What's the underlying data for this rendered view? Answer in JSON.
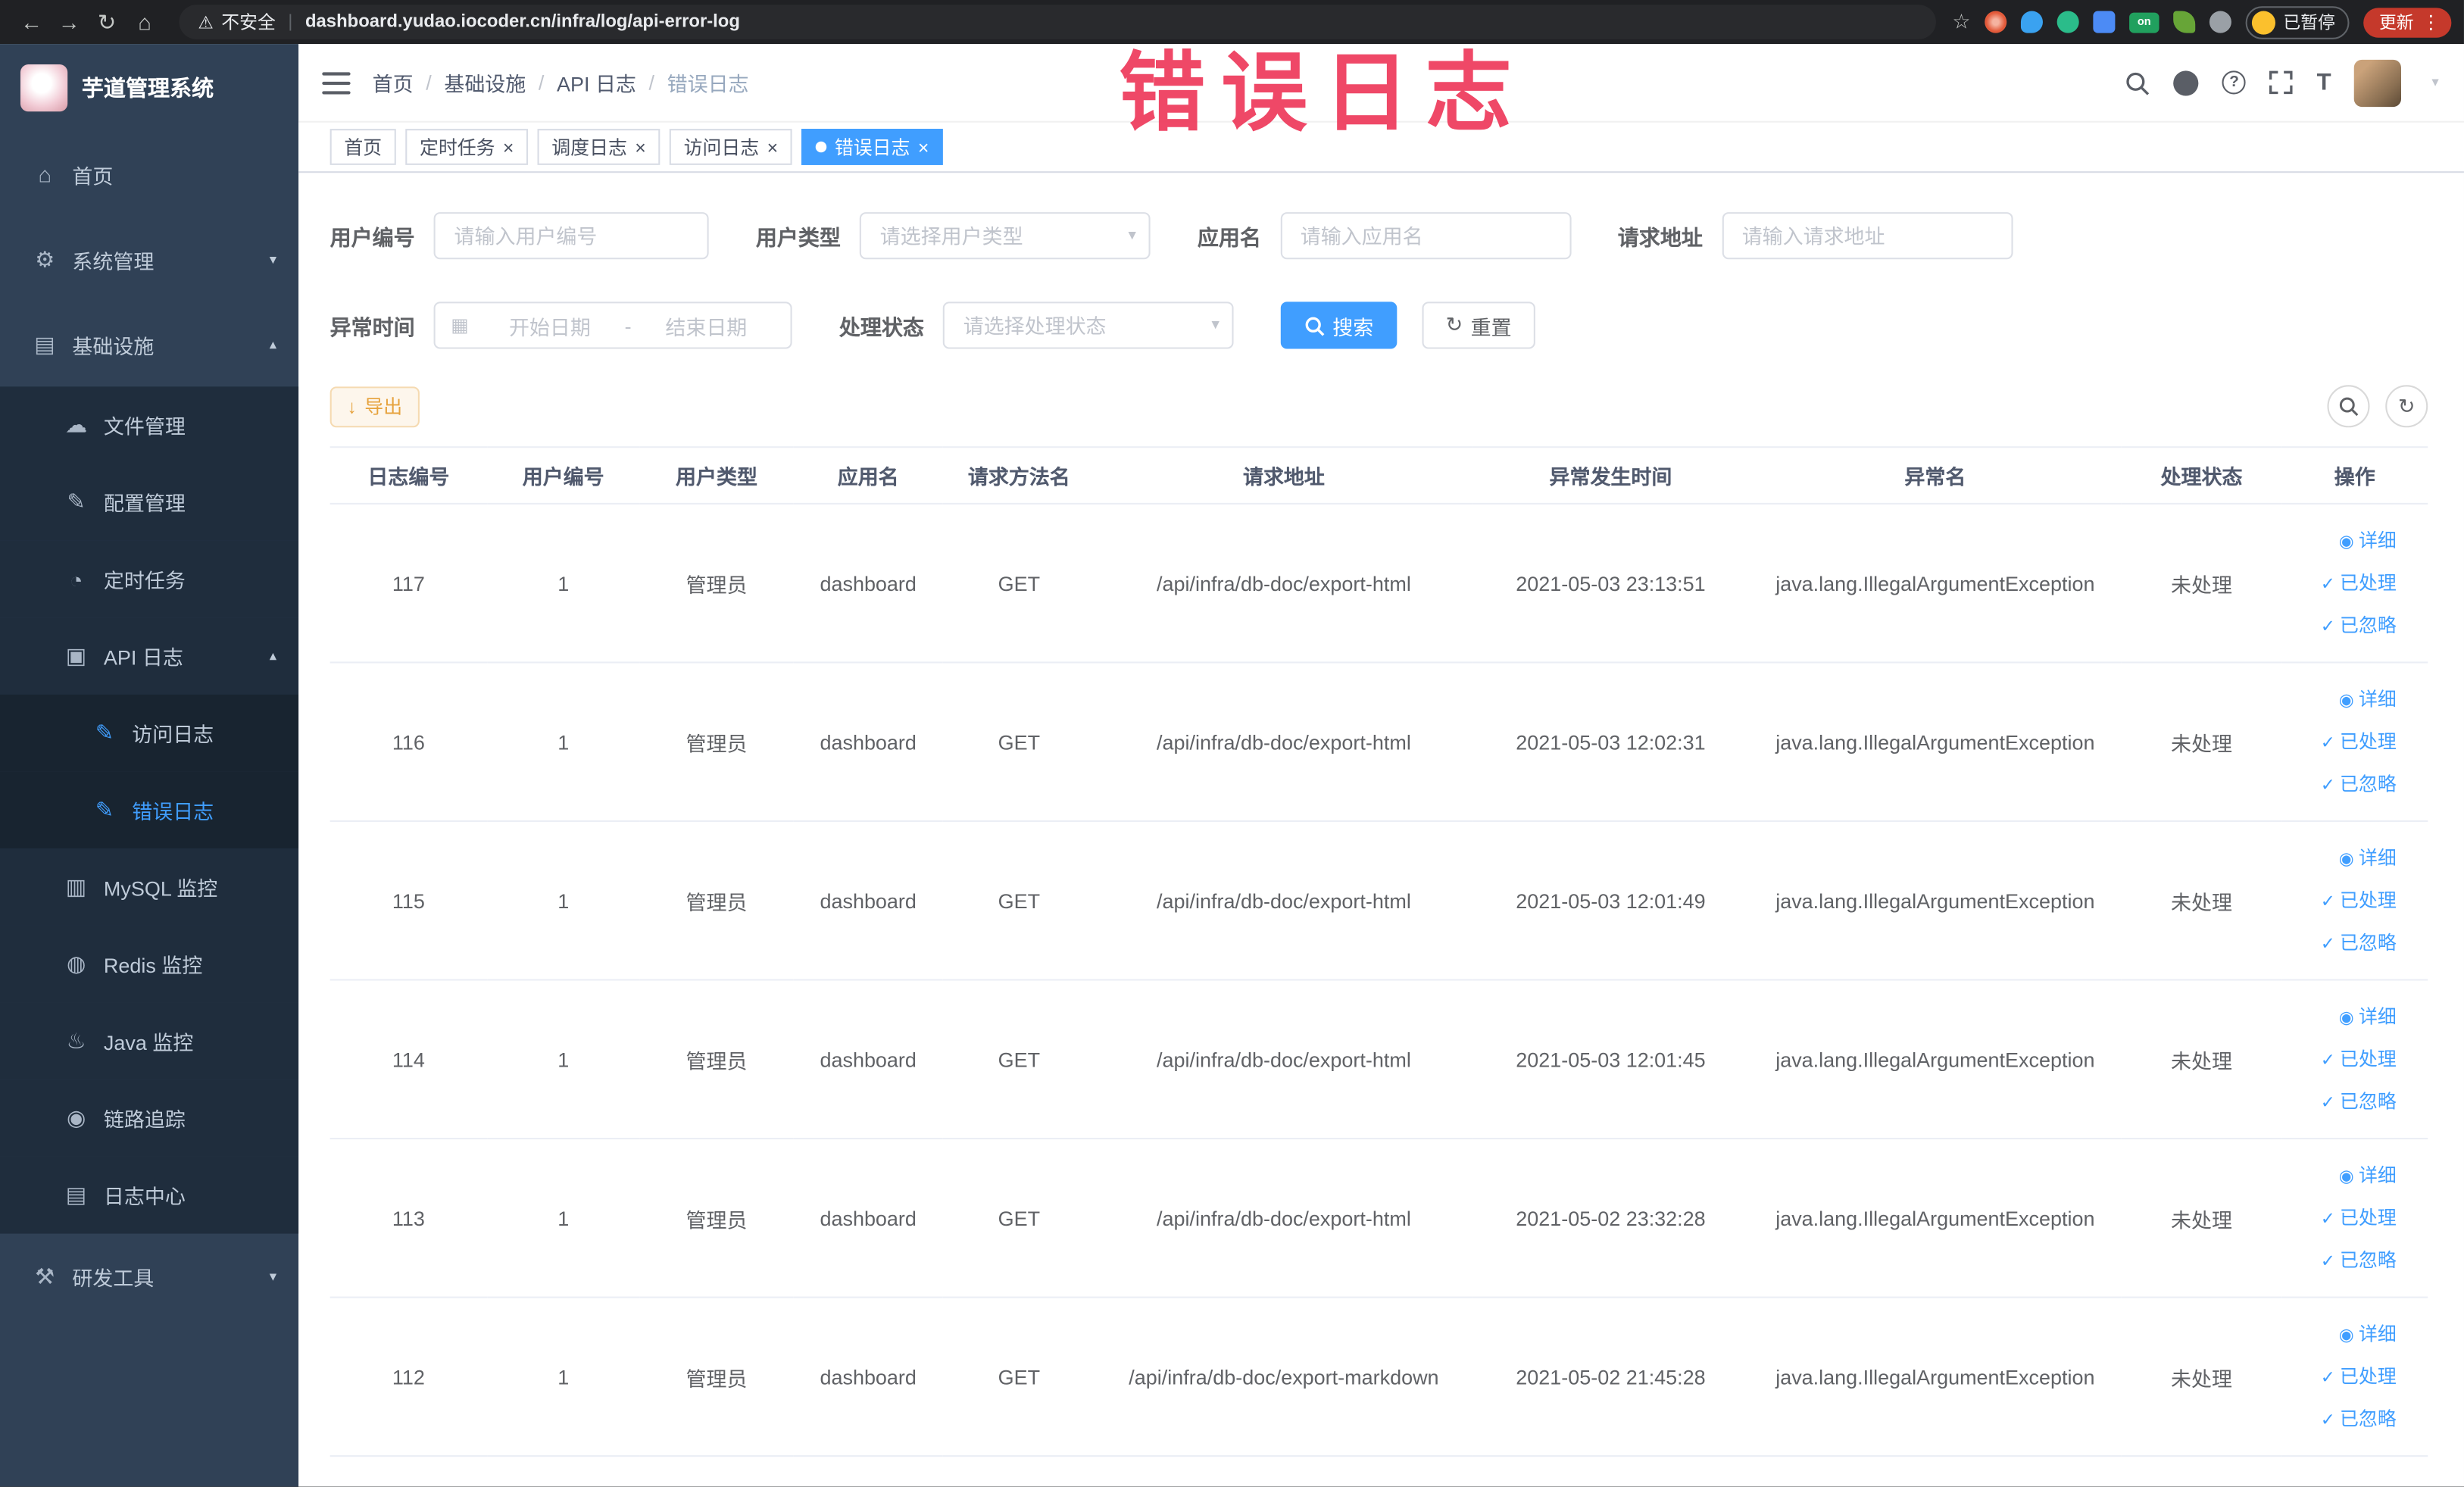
{
  "watermark": "错误日志",
  "browser": {
    "security_label": "不安全",
    "url": "dashboard.yudao.iocoder.cn/infra/log/api-error-log",
    "paused_badge": "已暂停",
    "update_button": "更新",
    "extension_on_badge": "on"
  },
  "sidebar": {
    "logo_title": "芋道管理系统",
    "items": [
      {
        "label": "首页"
      },
      {
        "label": "系统管理"
      },
      {
        "label": "基础设施"
      },
      {
        "label": "文件管理"
      },
      {
        "label": "配置管理"
      },
      {
        "label": "定时任务"
      },
      {
        "label": "API 日志"
      },
      {
        "label": "访问日志"
      },
      {
        "label": "错误日志"
      },
      {
        "label": "MySQL 监控"
      },
      {
        "label": "Redis 监控"
      },
      {
        "label": "Java 监控"
      },
      {
        "label": "链路追踪"
      },
      {
        "label": "日志中心"
      },
      {
        "label": "研发工具"
      }
    ]
  },
  "header": {
    "breadcrumbs": [
      "首页",
      "基础设施",
      "API 日志",
      "错误日志"
    ]
  },
  "tabs": [
    {
      "label": "首页"
    },
    {
      "label": "定时任务"
    },
    {
      "label": "调度日志"
    },
    {
      "label": "访问日志"
    },
    {
      "label": "错误日志"
    }
  ],
  "filters": {
    "user_id_label": "用户编号",
    "user_id_placeholder": "请输入用户编号",
    "user_type_label": "用户类型",
    "user_type_placeholder": "请选择用户类型",
    "app_name_label": "应用名",
    "app_name_placeholder": "请输入应用名",
    "request_url_label": "请求地址",
    "request_url_placeholder": "请输入请求地址",
    "exception_time_label": "异常时间",
    "date_start_placeholder": "开始日期",
    "date_separator": "-",
    "date_end_placeholder": "结束日期",
    "status_label": "处理状态",
    "status_placeholder": "请选择处理状态",
    "search_button": "搜索",
    "reset_button": "重置"
  },
  "toolbar": {
    "export_button": "导出"
  },
  "table": {
    "columns": [
      "日志编号",
      "用户编号",
      "用户类型",
      "应用名",
      "请求方法名",
      "请求地址",
      "异常发生时间",
      "异常名",
      "处理状态",
      "操作"
    ],
    "row_actions": [
      "详细",
      "已处理",
      "已忽略"
    ],
    "rows": [
      {
        "id": "117",
        "user_id": "1",
        "user_type": "管理员",
        "app": "dashboard",
        "method": "GET",
        "url": "/api/infra/db-doc/export-html",
        "time": "2021-05-03 23:13:51",
        "exception": "java.lang.IllegalArgumentException",
        "status": "未处理"
      },
      {
        "id": "116",
        "user_id": "1",
        "user_type": "管理员",
        "app": "dashboard",
        "method": "GET",
        "url": "/api/infra/db-doc/export-html",
        "time": "2021-05-03 12:02:31",
        "exception": "java.lang.IllegalArgumentException",
        "status": "未处理"
      },
      {
        "id": "115",
        "user_id": "1",
        "user_type": "管理员",
        "app": "dashboard",
        "method": "GET",
        "url": "/api/infra/db-doc/export-html",
        "time": "2021-05-03 12:01:49",
        "exception": "java.lang.IllegalArgumentException",
        "status": "未处理"
      },
      {
        "id": "114",
        "user_id": "1",
        "user_type": "管理员",
        "app": "dashboard",
        "method": "GET",
        "url": "/api/infra/db-doc/export-html",
        "time": "2021-05-03 12:01:45",
        "exception": "java.lang.IllegalArgumentException",
        "status": "未处理"
      },
      {
        "id": "113",
        "user_id": "1",
        "user_type": "管理员",
        "app": "dashboard",
        "method": "GET",
        "url": "/api/infra/db-doc/export-html",
        "time": "2021-05-02 23:32:28",
        "exception": "java.lang.IllegalArgumentException",
        "status": "未处理"
      },
      {
        "id": "112",
        "user_id": "1",
        "user_type": "管理员",
        "app": "dashboard",
        "method": "GET",
        "url": "/api/infra/db-doc/export-markdown",
        "time": "2021-05-02 21:45:28",
        "exception": "java.lang.IllegalArgumentException",
        "status": "未处理"
      }
    ]
  },
  "colors": {
    "accent": "#409eff",
    "warning": "#e6a23c",
    "sidebar_bg": "#304156",
    "submenu_bg": "#1f2d3d",
    "watermark": "#ee3b5c"
  }
}
